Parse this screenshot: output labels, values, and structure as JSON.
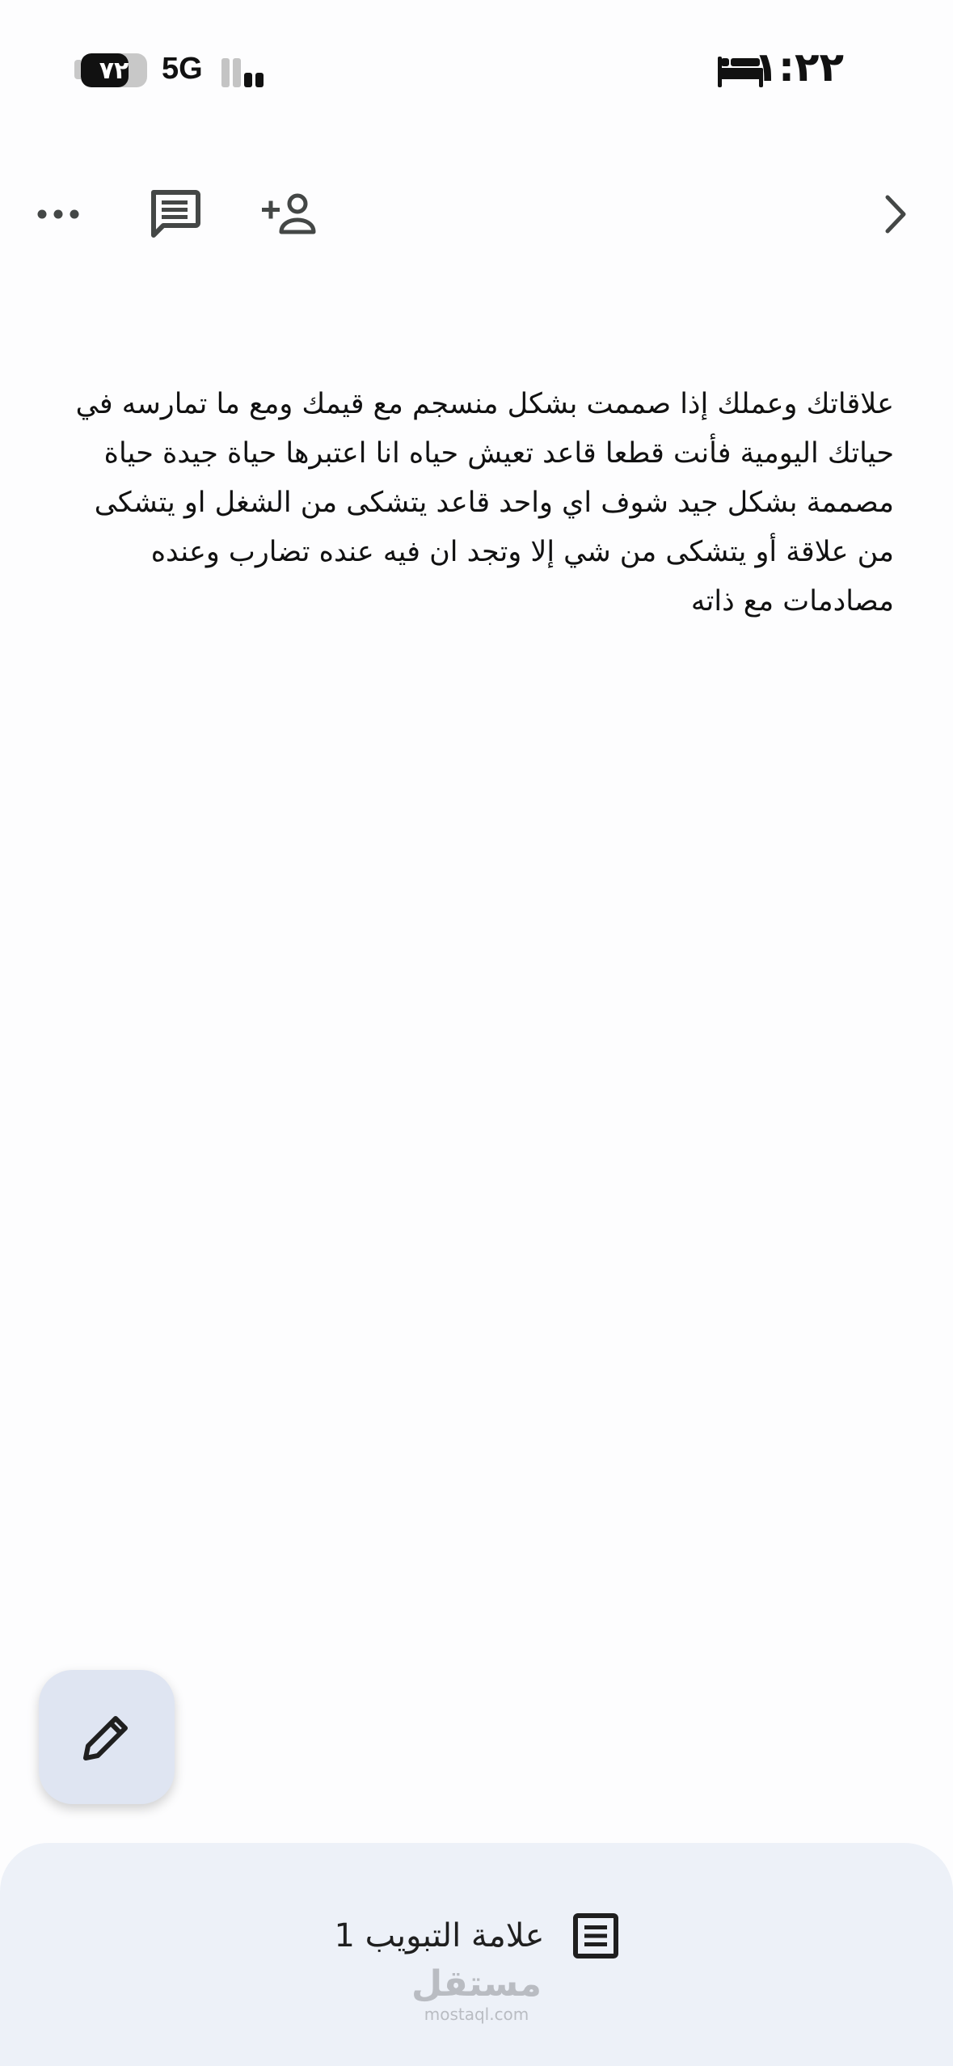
{
  "status_bar": {
    "time": "١:٢٢",
    "battery_text": "٧٢",
    "battery_level": 0.72,
    "network": "5G",
    "signal_bars_active": 2,
    "focus_icon": "bed-icon"
  },
  "toolbar": {
    "more_icon": "more-horizontal-icon",
    "comments_icon": "comment-icon",
    "share_icon": "add-person-icon",
    "forward_icon": "chevron-right-icon"
  },
  "document": {
    "body": "علاقاتك وعملك إذا صممت بشكل منسجم مع قيمك ومع ما تمارسه في حياتك اليومية فأنت قطعا قاعد تعيش حياه انا اعتبرها حياة جيدة حياة مصممة بشكل جيد شوف اي واحد قاعد يتشكى من الشغل او يتشكى من علاقة أو يتشكى من شي إلا وتجد ان فيه عنده تضارب وعنده مصادمات مع ذاته"
  },
  "fab": {
    "icon": "pencil-icon"
  },
  "bottom_sheet": {
    "tab_label": "علامة التبويب 1",
    "tab_icon": "document-list-icon"
  },
  "watermark": {
    "main": "مستقل",
    "sub": "mostaql.com"
  },
  "colors": {
    "background": "#fdfdfe",
    "fab_bg": "#dfe5f2",
    "sheet_bg": "#edf1f8",
    "icon": "#444746"
  }
}
